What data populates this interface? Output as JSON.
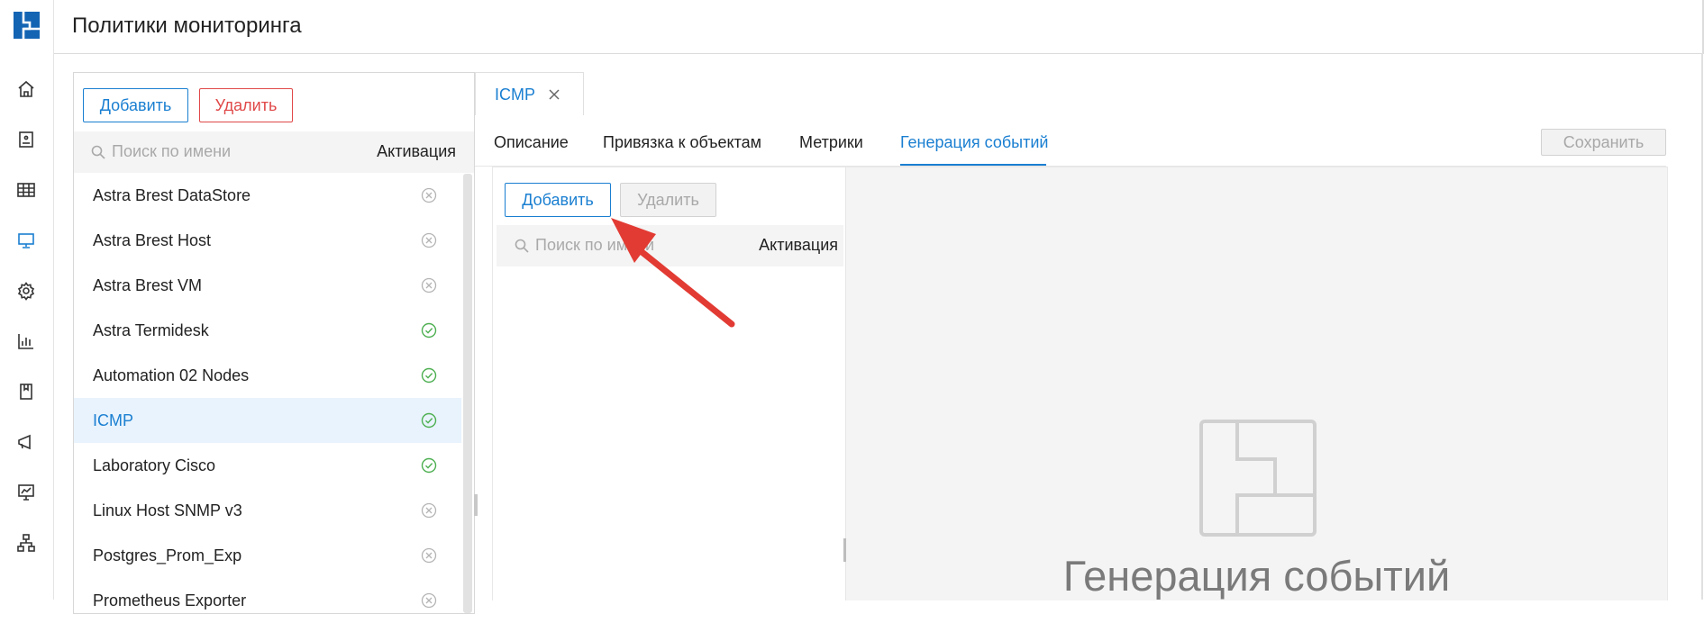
{
  "header": {
    "title": "Политики мониторинга"
  },
  "sidebar": {
    "logo": "app-logo",
    "items": [
      {
        "icon": "home-icon"
      },
      {
        "icon": "dashboard-icon"
      },
      {
        "icon": "table-icon"
      },
      {
        "icon": "monitor-icon",
        "active": true
      },
      {
        "icon": "gear-icon"
      },
      {
        "icon": "bar-chart-icon"
      },
      {
        "icon": "book-icon"
      },
      {
        "icon": "megaphone-icon"
      },
      {
        "icon": "presentation-chart-icon"
      },
      {
        "icon": "network-icon"
      }
    ]
  },
  "policies": {
    "add_label": "Добавить",
    "delete_label": "Удалить",
    "search_placeholder": "Поиск по имени",
    "activation_header": "Активация",
    "items": [
      {
        "name": "Astra Brest DataStore",
        "active": false
      },
      {
        "name": "Astra Brest Host",
        "active": false
      },
      {
        "name": "Astra Brest VM",
        "active": false
      },
      {
        "name": "Astra Termidesk",
        "active": true
      },
      {
        "name": "Automation 02 Nodes",
        "active": true
      },
      {
        "name": "ICMP",
        "active": true,
        "selected": true
      },
      {
        "name": "Laboratory Cisco",
        "active": true
      },
      {
        "name": "Linux Host SNMP v3",
        "active": false
      },
      {
        "name": "Postgres_Prom_Exp",
        "active": false
      },
      {
        "name": "Prometheus Exporter",
        "active": false
      }
    ]
  },
  "editor": {
    "open_tab": "ICMP",
    "tabs": [
      {
        "label": "Описание"
      },
      {
        "label": "Привязка к объектам"
      },
      {
        "label": "Метрики"
      },
      {
        "label": "Генерация событий",
        "active": true
      }
    ],
    "save_label": "Сохранить",
    "events": {
      "add_label": "Добавить",
      "delete_label": "Удалить",
      "search_placeholder": "Поиск по имени",
      "activation_header": "Активация",
      "empty_title": "Генерация событий"
    }
  },
  "colors": {
    "accent": "#1a7fd1",
    "danger": "#e04848",
    "active_status": "#4caf50",
    "inactive_status": "#b4b4b4",
    "annotation_arrow": "#e23b33"
  }
}
